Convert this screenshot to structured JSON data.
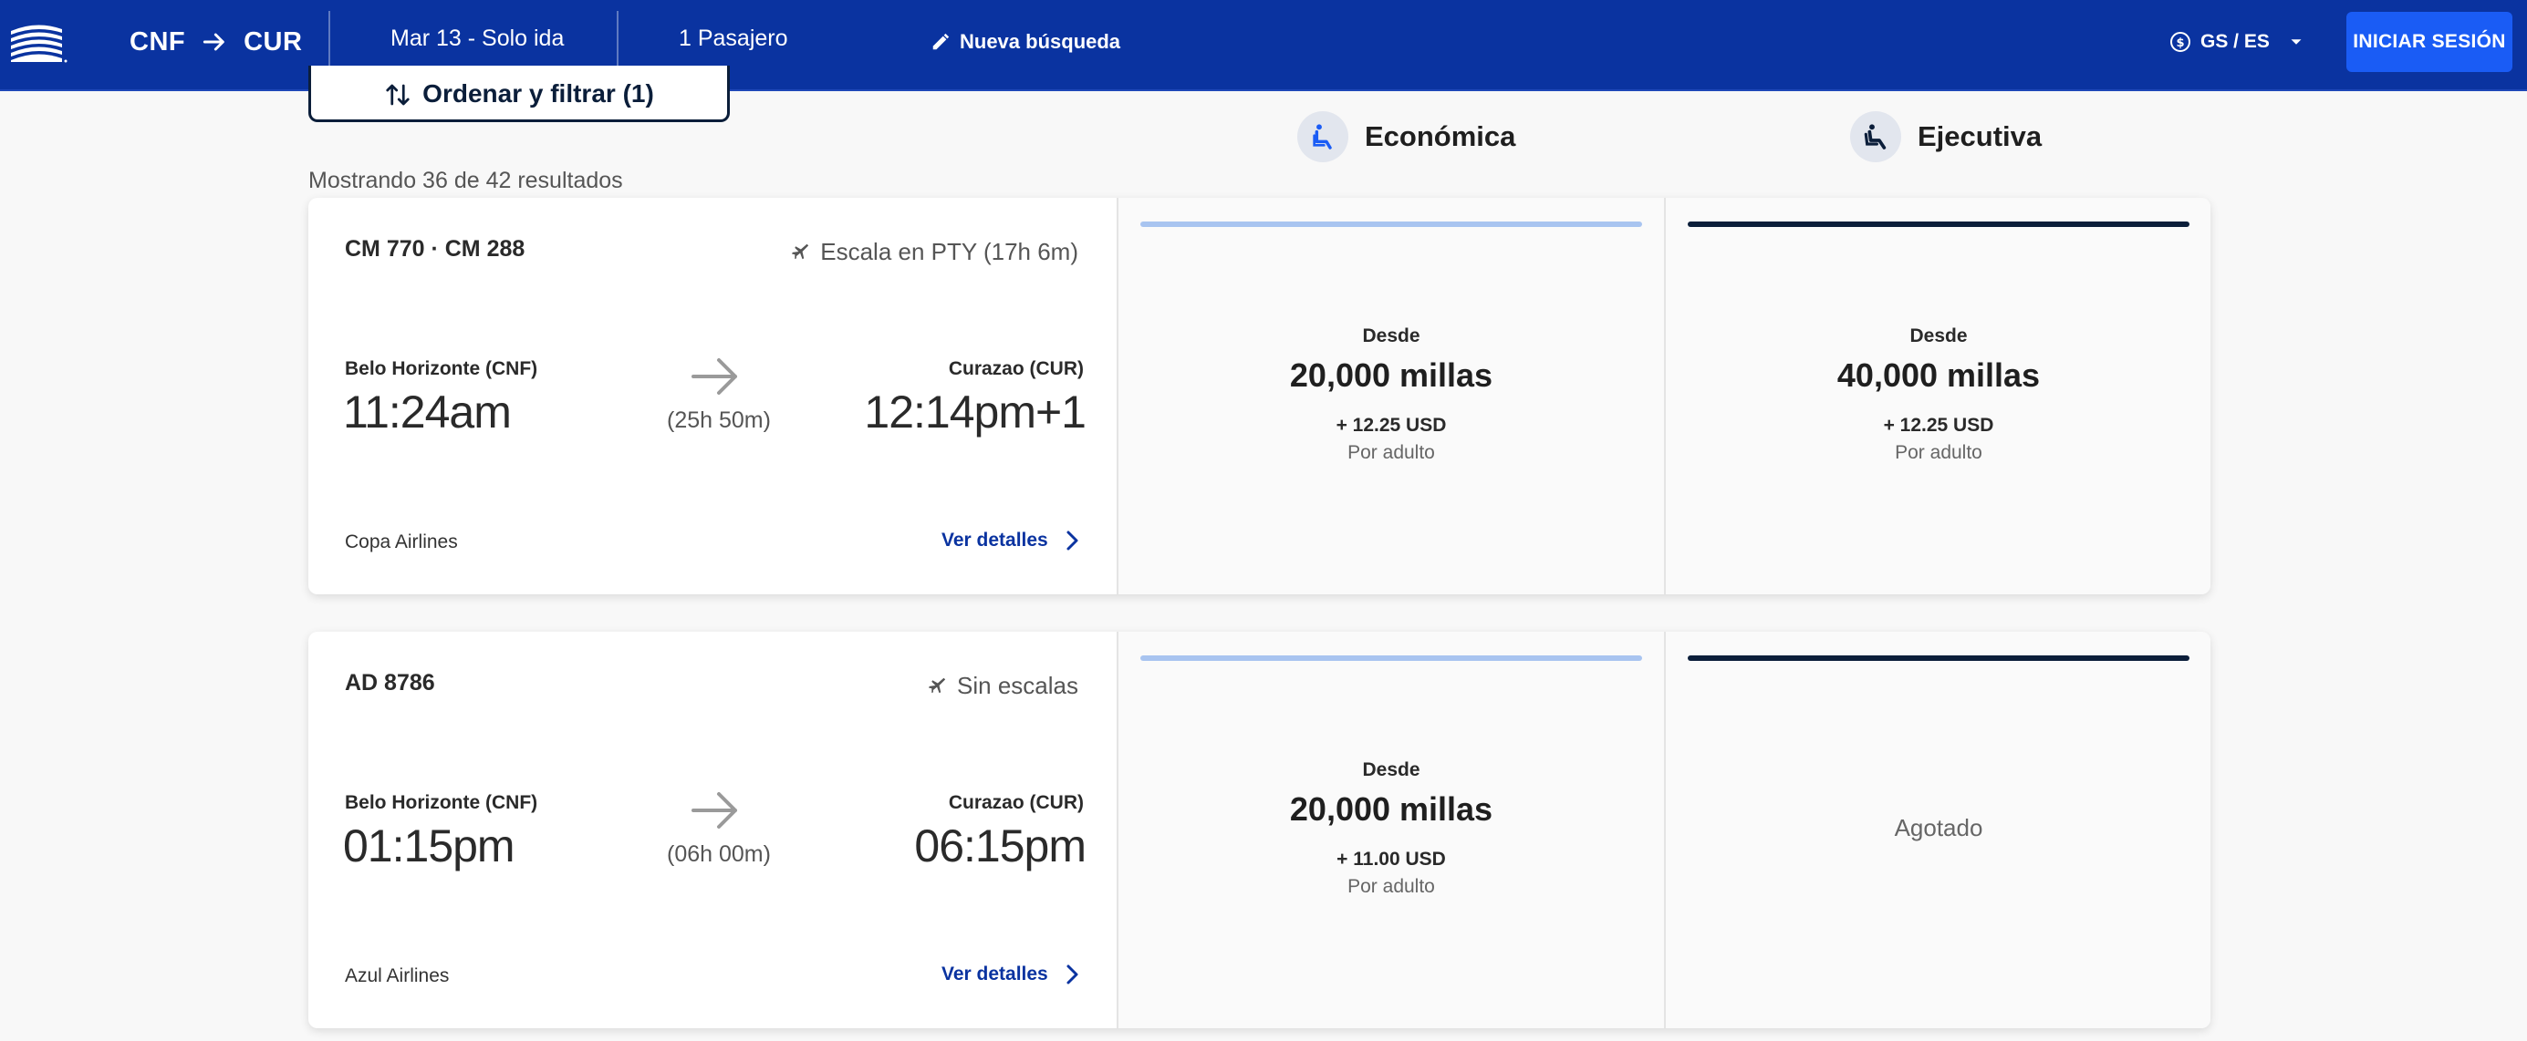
{
  "header": {
    "origin": "CNF",
    "destination": "CUR",
    "date_trip": "Mar 13 - Solo ida",
    "passengers": "1 Pasajero",
    "new_search": "Nueva búsqueda",
    "currency_lang": "GS / ES",
    "login": "INICIAR SESIÓN"
  },
  "toolbar": {
    "sort_filter": "Ordenar y filtrar (1)",
    "results_count": "Mostrando 36 de 42 resultados"
  },
  "cabins": {
    "economy": "Económica",
    "business": "Ejecutiva"
  },
  "colors": {
    "header_bg": "#0a33a0",
    "login_bg": "#1a5cf5",
    "economy_bar": "#a8c4f0",
    "business_bar": "#0b1e3a",
    "link": "#0a33a0"
  },
  "flights": [
    {
      "flight_number": "CM 770 · CM 288",
      "stops": "Escala en PTY (17h 6m)",
      "origin_city": "Belo Horizonte (CNF)",
      "departure_time": "11:24am",
      "duration": "(25h 50m)",
      "destination_city": "Curazao (CUR)",
      "arrival_time": "12:14pm+1",
      "airline": "Copa Airlines",
      "details": "Ver detalles",
      "economy": {
        "from": "Desde",
        "miles": "20,000 millas",
        "taxes": "+ 12.25 USD",
        "per": "Por adulto"
      },
      "business": {
        "from": "Desde",
        "miles": "40,000 millas",
        "taxes": "+ 12.25 USD",
        "per": "Por adulto"
      }
    },
    {
      "flight_number": "AD 8786",
      "stops": "Sin escalas",
      "origin_city": "Belo Horizonte (CNF)",
      "departure_time": "01:15pm",
      "duration": "(06h 00m)",
      "destination_city": "Curazao (CUR)",
      "arrival_time": "06:15pm",
      "airline": "Azul Airlines",
      "details": "Ver detalles",
      "economy": {
        "from": "Desde",
        "miles": "20,000 millas",
        "taxes": "+ 11.00 USD",
        "per": "Por adulto"
      },
      "business": {
        "sold_out": "Agotado"
      }
    }
  ]
}
